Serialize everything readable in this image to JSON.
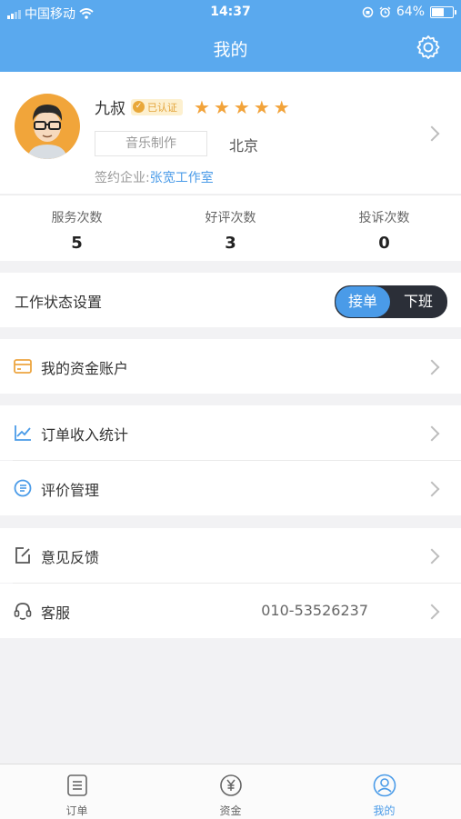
{
  "status_bar": {
    "carrier": "中国移动",
    "time": "14:37",
    "battery": "64%",
    "battery_level": 0.64
  },
  "header": {
    "title": "我的"
  },
  "profile": {
    "name": "九叔",
    "verified_label": "已认证",
    "rating_stars": 5,
    "tag": "音乐制作",
    "city": "北京",
    "company_label": "签约企业:",
    "company_name": "张宽工作室"
  },
  "stats": [
    {
      "label": "服务次数",
      "value": "5"
    },
    {
      "label": "好评次数",
      "value": "3"
    },
    {
      "label": "投诉次数",
      "value": "0"
    }
  ],
  "work_status": {
    "label": "工作状态设置",
    "on_label": "接单",
    "off_label": "下班",
    "selected": "接单"
  },
  "menu": {
    "fund_account": "我的资金账户",
    "order_income": "订单收入统计",
    "review_manage": "评价管理",
    "feedback": "意见反馈",
    "service": "客服",
    "service_phone": "010-53526237"
  },
  "tabs": [
    {
      "label": "订单",
      "icon": "order-list-icon"
    },
    {
      "label": "资金",
      "icon": "yuan-icon"
    },
    {
      "label": "我的",
      "icon": "user-icon"
    }
  ],
  "colors": {
    "accent": "#5aa9ee",
    "star": "#f2a33a",
    "link": "#4a9be8"
  }
}
